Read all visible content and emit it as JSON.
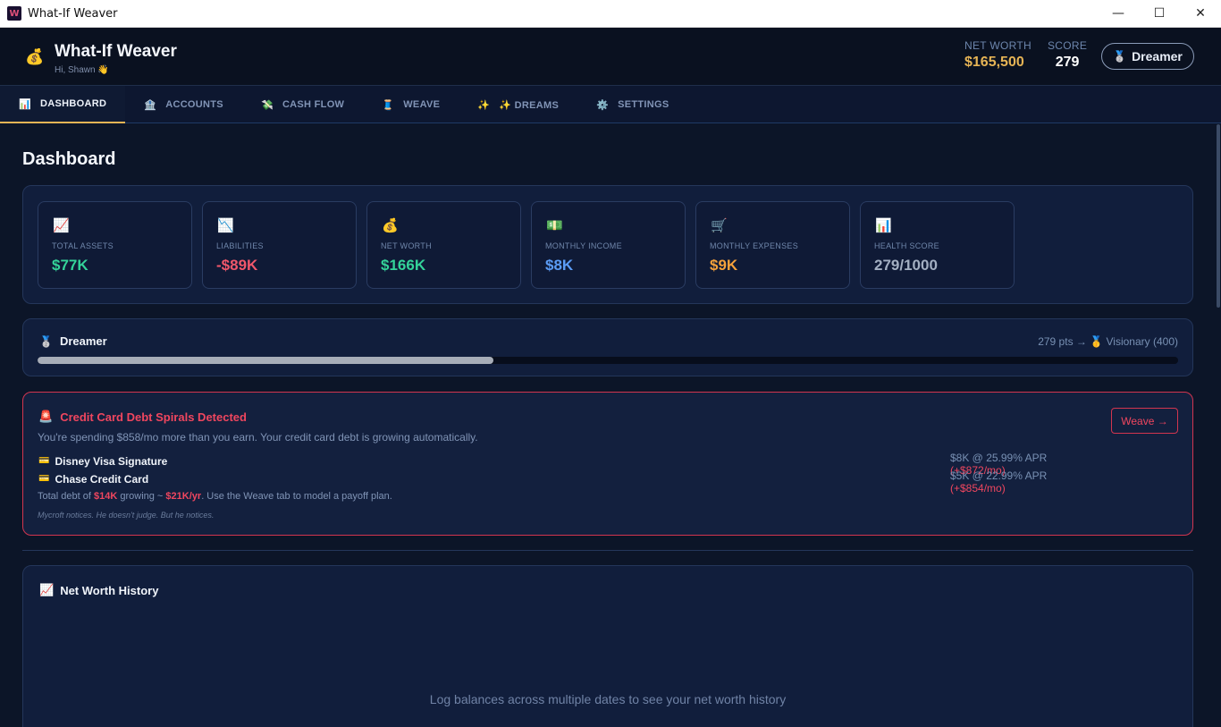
{
  "window": {
    "title": "What-If Weaver",
    "controls": {
      "minimize": "—",
      "maximize": "☐",
      "close": "✕"
    }
  },
  "header": {
    "brand_icon": "💰",
    "brand_name": "What-If Weaver",
    "greeting": "Hi, Shawn 👋",
    "net_worth_label": "NET WORTH",
    "net_worth_value": "$165,500",
    "score_label": "SCORE",
    "score_value": "279",
    "rank_medal": "🥈",
    "rank_label": "Dreamer"
  },
  "tabs": [
    {
      "icon": "📊",
      "label": "DASHBOARD",
      "active": true
    },
    {
      "icon": "🏦",
      "label": "ACCOUNTS"
    },
    {
      "icon": "💸",
      "label": "CASH FLOW"
    },
    {
      "icon": "🧵",
      "label": "WEAVE"
    },
    {
      "icon": "✨",
      "label": "✨ DREAMS"
    },
    {
      "icon": "⚙️",
      "label": "SETTINGS"
    }
  ],
  "page": {
    "title": "Dashboard"
  },
  "stats": [
    {
      "icon": "📈",
      "label": "TOTAL ASSETS",
      "value": "$77K",
      "color": "#34d399"
    },
    {
      "icon": "📉",
      "label": "LIABILITIES",
      "value": "-$89K",
      "color": "#f0576b"
    },
    {
      "icon": "💰",
      "label": "NET WORTH",
      "value": "$166K",
      "color": "#34d399"
    },
    {
      "icon": "💵",
      "label": "MONTHLY INCOME",
      "value": "$8K",
      "color": "#5b9cf5"
    },
    {
      "icon": "🛒",
      "label": "MONTHLY EXPENSES",
      "value": "$9K",
      "color": "#f5a13b"
    },
    {
      "icon": "📊",
      "label": "HEALTH SCORE",
      "value": "279/1000",
      "color": "#a3afc2"
    }
  ],
  "level": {
    "medal": "🥈",
    "name": "Dreamer",
    "next": "279 pts → 🥇 Visionary (400)",
    "progress": 0.4
  },
  "alert": {
    "icon": "🚨",
    "title": "Credit Card Debt Spirals Detected",
    "description": "You're spending $858/mo more than you earn. Your credit card debt is growing automatically.",
    "button": "Weave →",
    "debts": [
      {
        "icon": "💳",
        "name": "Disney Visa Signature",
        "info": "$8K @ 25.99% APR",
        "growth": "(+$872/mo)"
      },
      {
        "icon": "💳",
        "name": "Chase Credit Card",
        "info": "$5K @ 22.99% APR",
        "growth": "(+$854/mo)"
      }
    ],
    "summary": {
      "prefix": "Total debt of ",
      "total": "$14K",
      "middle": " growing ~ ",
      "rate": "$21K/yr",
      "suffix": ". Use the Weave tab to model a payoff plan."
    },
    "note": "Mycroft notices. He doesn't judge. But he notices."
  },
  "history": {
    "icon": "📈",
    "title": "Net Worth History",
    "empty": "Log balances across multiple dates to see your net worth history"
  }
}
